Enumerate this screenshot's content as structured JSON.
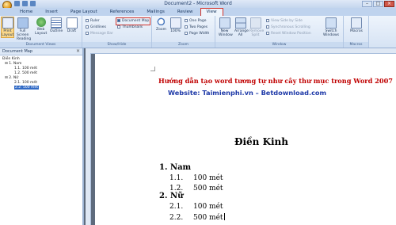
{
  "window": {
    "title": "Document2 - Microsoft Word"
  },
  "tabs": [
    "Home",
    "Insert",
    "Page Layout",
    "References",
    "Mailings",
    "Review",
    "View"
  ],
  "ribbon": {
    "document_views": {
      "label": "Document Views",
      "buttons": [
        "Print Layout",
        "Full Screen Reading",
        "Web Layout",
        "Outline",
        "Draft"
      ]
    },
    "show_hide": {
      "label": "Show/Hide",
      "ruler": "Ruler",
      "gridlines": "Gridlines",
      "message_bar": "Message Bar",
      "document_map": "Document Map",
      "thumbnails": "Thumbnails"
    },
    "zoom": {
      "label": "Zoom",
      "zoom": "Zoom",
      "percent": "100%",
      "one_page": "One Page",
      "two_pages": "Two Pages",
      "page_width": "Page Width"
    },
    "window": {
      "label": "Window",
      "new_window": "New Window",
      "arrange_all": "Arrange All",
      "split": "Remove Split",
      "view_side": "View Side by Side",
      "sync_scroll": "Synchronous Scrolling",
      "reset_pos": "Reset Window Position",
      "switch": "Switch Windows"
    },
    "macros": {
      "label": "Macros",
      "button": "Macros"
    }
  },
  "document_map": {
    "title": "Document Map",
    "items": [
      {
        "text": "Điền Kinh",
        "level": 0
      },
      {
        "text": "1. Nam",
        "level": 1
      },
      {
        "text": "1.1. 100 mét",
        "level": 2
      },
      {
        "text": "1.2. 500 mét",
        "level": 2
      },
      {
        "text": "2. Nữ",
        "level": 1
      },
      {
        "text": "2.1. 100 mét",
        "level": 2
      },
      {
        "text": "2.2. 500 mét",
        "level": 2
      }
    ]
  },
  "document": {
    "heading_red": "Hướng dẫn tạo word tương tự như cây thư mục trong Word 2007",
    "heading_blue": "Website: Taimienphi.vn – Betdownload.com",
    "title": "Điền Kinh",
    "list": [
      {
        "num": "1.",
        "text": "Nam"
      },
      {
        "num": "1.1.",
        "text": "100 mét"
      },
      {
        "num": "1.2.",
        "text": "500 mét"
      },
      {
        "num": "2.",
        "text": "Nữ"
      },
      {
        "num": "2.1.",
        "text": "100 mét"
      },
      {
        "num": "2.2.",
        "text": "500 mét"
      }
    ]
  }
}
